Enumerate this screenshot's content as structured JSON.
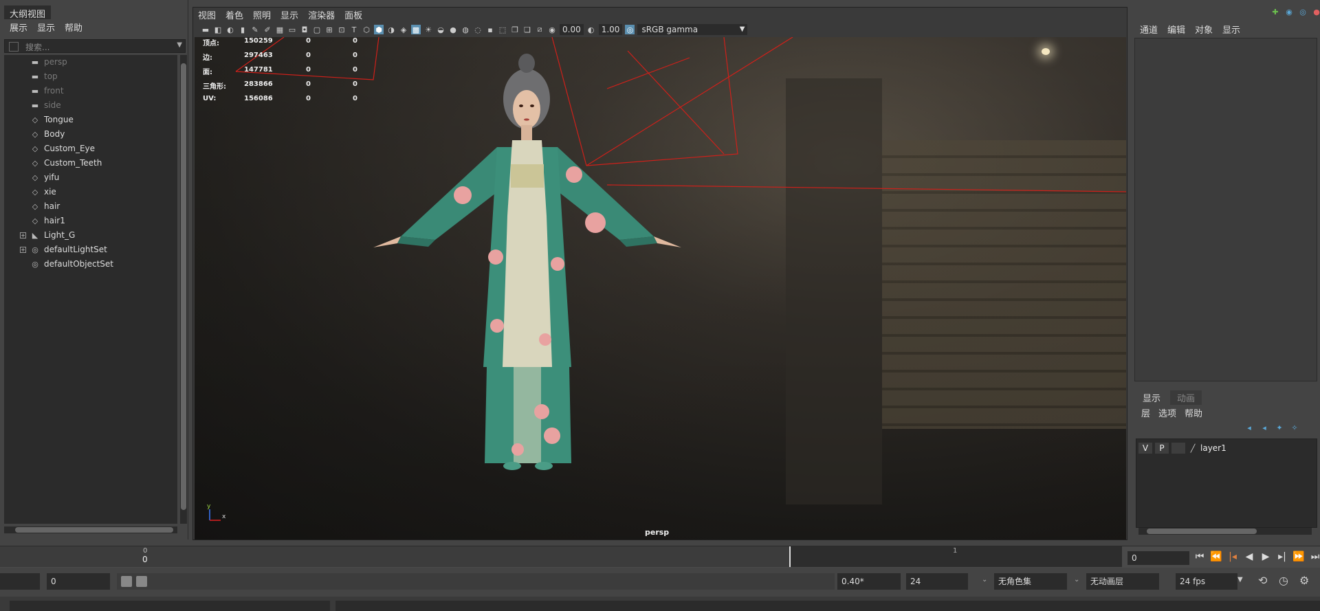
{
  "outliner": {
    "tab": "大纲视图",
    "menu": [
      "展示",
      "显示",
      "帮助"
    ],
    "search_placeholder": "搜索...",
    "items": [
      {
        "label": "persp",
        "type": "camera",
        "dim": true
      },
      {
        "label": "top",
        "type": "camera",
        "dim": true
      },
      {
        "label": "front",
        "type": "camera",
        "dim": true
      },
      {
        "label": "side",
        "type": "camera",
        "dim": true
      },
      {
        "label": "Tongue",
        "type": "mesh",
        "dim": false
      },
      {
        "label": "Body",
        "type": "mesh",
        "dim": false
      },
      {
        "label": "Custom_Eye",
        "type": "mesh",
        "dim": false
      },
      {
        "label": "Custom_Teeth",
        "type": "mesh",
        "dim": false
      },
      {
        "label": "yifu",
        "type": "mesh",
        "dim": false
      },
      {
        "label": "xie",
        "type": "mesh",
        "dim": false
      },
      {
        "label": "hair",
        "type": "mesh",
        "dim": false
      },
      {
        "label": "hair1",
        "type": "mesh",
        "dim": false
      },
      {
        "label": "Light_G",
        "type": "light",
        "dim": false
      },
      {
        "label": "defaultLightSet",
        "type": "set",
        "dim": false
      },
      {
        "label": "defaultObjectSet",
        "type": "set",
        "dim": false
      }
    ]
  },
  "viewport": {
    "menu": [
      "视图",
      "着色",
      "照明",
      "显示",
      "渲染器",
      "面板"
    ],
    "exposure": "0.00",
    "gamma": "1.00",
    "color_space": "sRGB gamma",
    "camera": "persp",
    "hud": [
      {
        "label": "顶点:",
        "v1": "150259",
        "v2": "0",
        "v3": "0"
      },
      {
        "label": "边:",
        "v1": "297463",
        "v2": "0",
        "v3": "0"
      },
      {
        "label": "面:",
        "v1": "147781",
        "v2": "0",
        "v3": "0"
      },
      {
        "label": "三角形:",
        "v1": "283866",
        "v2": "0",
        "v3": "0"
      },
      {
        "label": "UV:",
        "v1": "156086",
        "v2": "0",
        "v3": "0"
      }
    ],
    "axis_x": "x",
    "axis_y": "y"
  },
  "channel_box": {
    "menu": [
      "通道",
      "编辑",
      "对象",
      "显示"
    ]
  },
  "layer_editor": {
    "tabs": [
      "显示",
      "动画"
    ],
    "menu": [
      "层",
      "选项",
      "帮助"
    ],
    "layer": {
      "v": "V",
      "p": "P",
      "name": "layer1"
    }
  },
  "timeline": {
    "start_mark": "0",
    "start_label": "0",
    "marker": "1",
    "current_frame": "0"
  },
  "range": {
    "start": "0",
    "playback_speed": "0.40*",
    "end": "24",
    "character_set": "无角色集",
    "anim_layer": "无动画层",
    "fps": "24 fps"
  }
}
